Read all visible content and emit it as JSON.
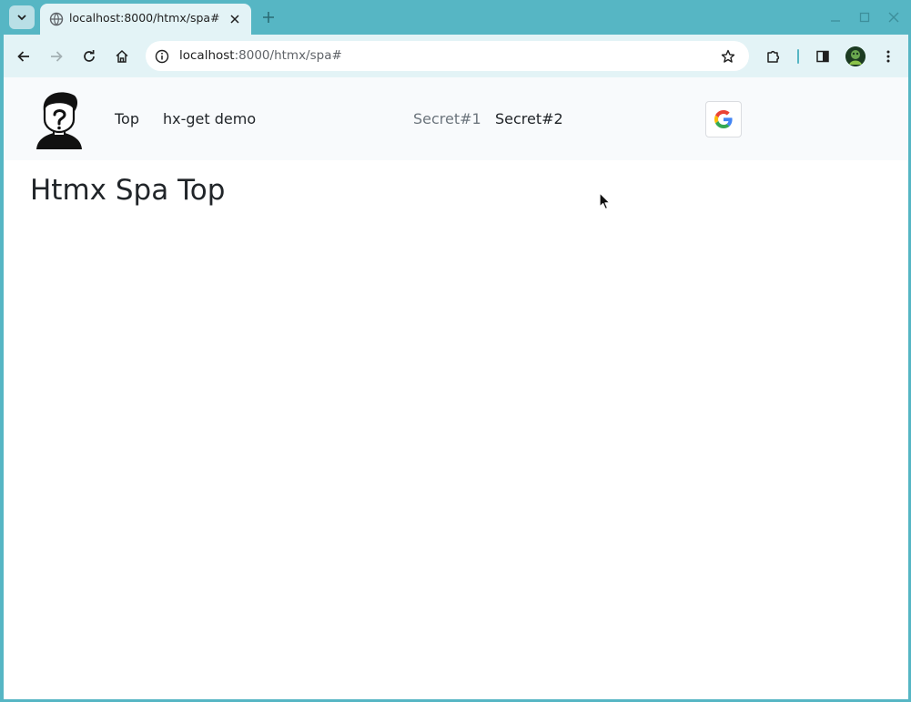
{
  "browser": {
    "tab": {
      "title": "localhost:8000/htmx/spa#"
    },
    "address": {
      "host": "localhost",
      "path": ":8000/htmx/spa#"
    }
  },
  "page": {
    "nav": {
      "links": [
        {
          "label": "Top"
        },
        {
          "label": "hx-get demo"
        },
        {
          "label": "Secret#1"
        },
        {
          "label": "Secret#2"
        }
      ],
      "login_provider_icon": "google-g-icon"
    },
    "title": "Htmx Spa Top"
  },
  "colors": {
    "frame": "#56b6c4",
    "toolbar": "#e3f3f6",
    "navbar": "#f8fafc",
    "text": "#212529",
    "muted_link": "#6c757d"
  }
}
